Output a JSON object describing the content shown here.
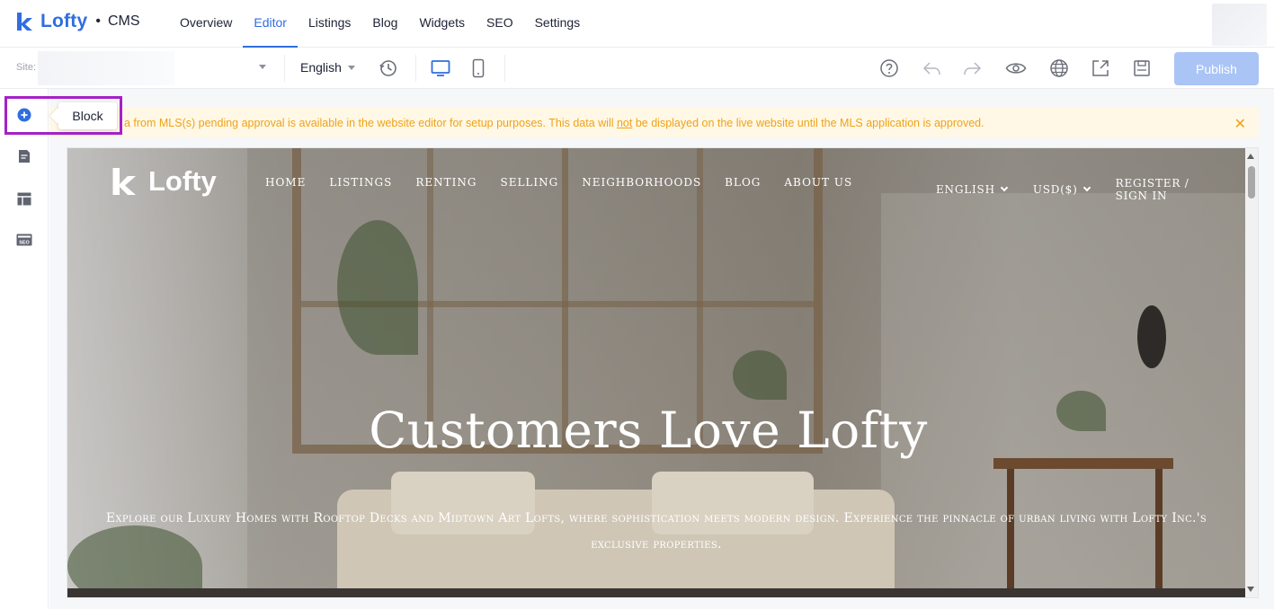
{
  "app": {
    "brand": "Lofty",
    "separator": "•",
    "product": "CMS"
  },
  "nav": {
    "items": [
      {
        "label": "Overview"
      },
      {
        "label": "Editor",
        "active": true
      },
      {
        "label": "Listings"
      },
      {
        "label": "Blog"
      },
      {
        "label": "Widgets"
      },
      {
        "label": "SEO"
      },
      {
        "label": "Settings"
      }
    ]
  },
  "toolbar": {
    "site_label": "Site:",
    "language": "English",
    "icons": [
      "history-icon",
      "desktop-icon",
      "mobile-icon",
      "help-icon",
      "undo-icon",
      "redo-icon",
      "preview-icon",
      "globe-icon",
      "share-icon",
      "save-icon"
    ],
    "publish_label": "Publish"
  },
  "sidebar": {
    "icons": [
      "add-block-icon",
      "page-icon",
      "layout-icon",
      "seo-icon"
    ],
    "tooltip": "Block"
  },
  "warning": {
    "text_before": "a from MLS(s) pending approval is available in the website editor for setup purposes. This data will ",
    "text_underlined": "not",
    "text_after": " be displayed on the live website until the MLS application is approved.",
    "close": "✕"
  },
  "site": {
    "logo_text": "Lofty",
    "nav": [
      "HOME",
      "LISTINGS",
      "RENTING",
      "SELLING",
      "NEIGHBORHOODS",
      "BLOG",
      "ABOUT US"
    ],
    "right": {
      "language": "ENGLISH",
      "currency": "USD($)",
      "auth": "REGISTER / SIGN IN"
    },
    "hero_title": "Customers Love Lofty",
    "hero_subtitle": "Explore our Luxury Homes with Rooftop Decks and Midtown Art Lofts, where sophistication meets modern design. Experience the pinnacle of urban living with Lofty Inc.'s exclusive properties."
  },
  "colors": {
    "accent": "#2f6ee0",
    "publish_bg": "#aac4f5",
    "warning_bg": "#fff8e6",
    "warning_text": "#f0a217",
    "highlight": "#a520c8"
  }
}
